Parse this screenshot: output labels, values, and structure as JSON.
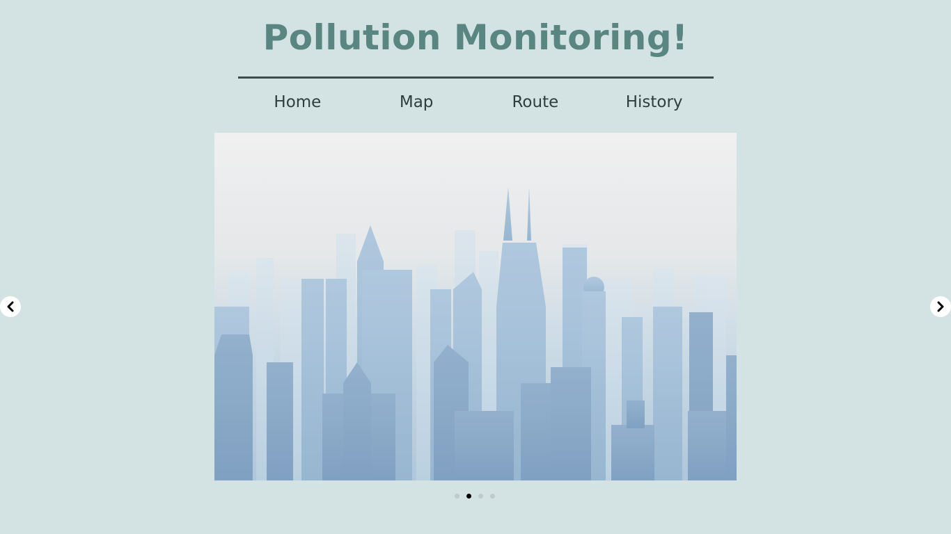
{
  "header": {
    "title": "Pollution Monitoring!"
  },
  "nav": {
    "items": [
      {
        "label": "Home"
      },
      {
        "label": "Map"
      },
      {
        "label": "Route"
      },
      {
        "label": "History"
      }
    ]
  },
  "carousel": {
    "image_description_icon": "city-skyline-smog-image",
    "prev_icon": "chevron-left-icon",
    "next_icon": "chevron-right-icon",
    "slide_count": 4,
    "active_index": 1
  },
  "colors": {
    "background": "#d3e2e3",
    "title": "#5a8682",
    "nav_text": "#2f3d3e",
    "rule": "#384a4a"
  }
}
